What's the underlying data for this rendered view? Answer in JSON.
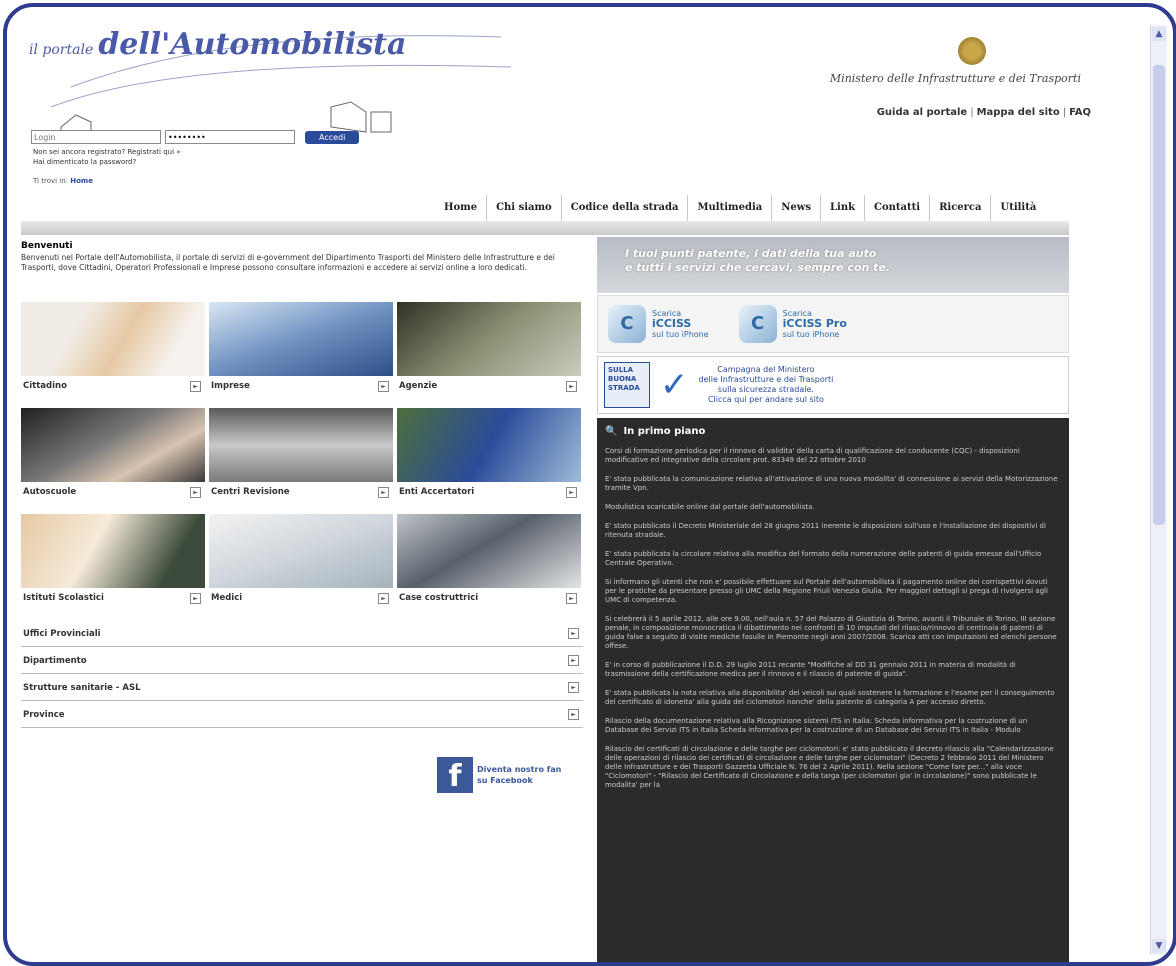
{
  "header": {
    "logo_line1": "il portale",
    "logo_line2": "dell'Automobilista",
    "ministry": "Ministero delle Infrastrutture e dei Trasporti",
    "links": [
      "Guida al portale",
      "Mappa del sito",
      "FAQ"
    ],
    "login_placeholder": "Login",
    "password_value": "••••••••",
    "login_button": "Accedi",
    "register_text": "Non sei ancora registrato? Registrati qui »",
    "forgot_text": "Hai dimenticato la password?",
    "breadcrumb_prefix": "Ti trovi in: ",
    "breadcrumb_current": "Home"
  },
  "nav": [
    "Home",
    "Chi siamo",
    "Codice della strada",
    "Multimedia",
    "News",
    "Link",
    "Contatti",
    "Ricerca",
    "Utilità"
  ],
  "welcome": {
    "title": "Benvenuti",
    "text": "Benvenuti nel Portale dell'Automobilista, il portale di servizi di e-government del Dipartimento Trasporti del Ministero delle Infrastrutture e dei Trasporti, dove Cittadini, Operatori Professionali e Imprese possono consultare informazioni e accedere ai servizi online a loro dedicati."
  },
  "tiles": [
    {
      "label": "Cittadino",
      "icon": "photo-cittadino"
    },
    {
      "label": "Imprese",
      "icon": "photo-imprese"
    },
    {
      "label": "Agenzie",
      "icon": "photo-agenzie"
    },
    {
      "label": "Autoscuole",
      "icon": "photo-autoscuole"
    },
    {
      "label": "Centri Revisione",
      "icon": "photo-centri-revisione"
    },
    {
      "label": "Enti Accertatori",
      "icon": "photo-enti-accertatori"
    },
    {
      "label": "Istituti Scolastici",
      "icon": "photo-istituti"
    },
    {
      "label": "Medici",
      "icon": "photo-medici"
    },
    {
      "label": "Case costruttrici",
      "icon": "photo-case-costruttrici"
    }
  ],
  "accordion": [
    "Uffici Provinciali",
    "Dipartimento",
    "Strutture sanitarie - ASL",
    "Province"
  ],
  "facebook": {
    "line1": "Diventa nostro fan",
    "line2": "su Facebook"
  },
  "right": {
    "banner_line1": "I tuoi punti patente, i dati della tua auto",
    "banner_line2": "e tutti i servizi che cercavi, sempre con te.",
    "app1": {
      "top": "Scarica",
      "name": "iCCISS",
      "sub": "sul tuo iPhone"
    },
    "app2": {
      "top": "Scarica",
      "name": "iCCISS Pro",
      "sub": "sul tuo iPhone"
    },
    "campaign_logo": "SULLA BUONA STRADA",
    "campaign": [
      "Campagna del Ministero",
      "delle Infrastrutture e dei Trasporti",
      "sulla sicurezza stradale.",
      "Clicca qui per andare sul sito"
    ]
  },
  "news": {
    "title": "In primo piano",
    "items": [
      "Corsi di formazione periodica per il rinnovo di validita' della carta di qualificazione del conducente (CQC) - disposizioni modificative ed integrative della circolare prot. 83349 del 22 ottobre 2010",
      "E' stata pubblicata la comunicazione relativa all'attivazione di una nuova modalita' di connessione ai servizi della Motorizzazione tramite Vpn.",
      "Modulistica scaricabile online dal portale dell'automobilista.",
      "E' stato pubblicato il Decreto Ministeriale del 28 giugno 2011 inerente le disposizioni sull'uso e l'installazione dei dispositivi di ritenuta stradale.",
      "E' stata pubblicata la circolare relativa alla modifica del formato della numerazione delle patenti di guida emesse dall'Ufficio Centrale Operativo.",
      "Si informano gli utenti che non e' possibile effettuare sul Portale dell'automobilista il pagamento online dei corrispettivi dovuti per le pratiche da presentare presso gli UMC della Regione Friuli Venezia Giulia. Per maggiori dettagli si prega di rivolgersi agli UMC di competenza.",
      "Si celebrerà il 5 aprile 2012, alle ore 9.00, nell'aula n. 57 del Palazzo di Giustizia di Torino, avanti il Tribunale di Torino, III sezione penale, in composizione monocratica il dibattimento nei confronti di 10 imputati del rilascio/rinnovo di centinaia di patenti di guida false a seguito di visite mediche fasulle in Piemonte negli anni 2007/2008. Scarica atti con imputazioni ed elenchi persone offese.",
      "E' in corso di pubblicazione il D.D. 29 luglio 2011 recante \"Modifiche al DD 31 gennaio 2011 in materia di modalità di trasmissione della certificazione medica per il rinnovo e il rilascio di patente di guida\".",
      "E' stata pubblicata la nota relativa alla disponibilita' dei veicoli sui quali sostenere la formazione e l'esame per il conseguimento del certificato di idoneita' alla guida del ciclomotori nonche' della patente di categoria A per accesso diretto.",
      "Rilascio della documentazione relativa alla Ricognizione sistemi ITS in Italia: Scheda informativa per la costruzione di un Database dei Servizi ITS in Italia Scheda informativa per la costruzione di un Database dei Servizi ITS in Italia - Modulo",
      "Rilascio dei certificati di circolazione e delle targhe per ciclomotori: e' stato pubblicato il decreto rilascio alla \"Calendarizzazione delle operazioni di rilascio dei certificati di circolazione e delle targhe per ciclomotori\" (Decreto 2 febbraio 2011 del Ministero delle Infrastrutture e dei Trasporti Gazzetta Ufficiale N. 76 del 2 Aprile 2011). Nella sezione \"Come fare per...\" alla voce \"Ciclomotori\" - \"Rilascio del Certificato di Circolazione e della targa (per ciclomotori gia' in circolazione)\" sono pubblicate le modalita' per la"
    ]
  }
}
